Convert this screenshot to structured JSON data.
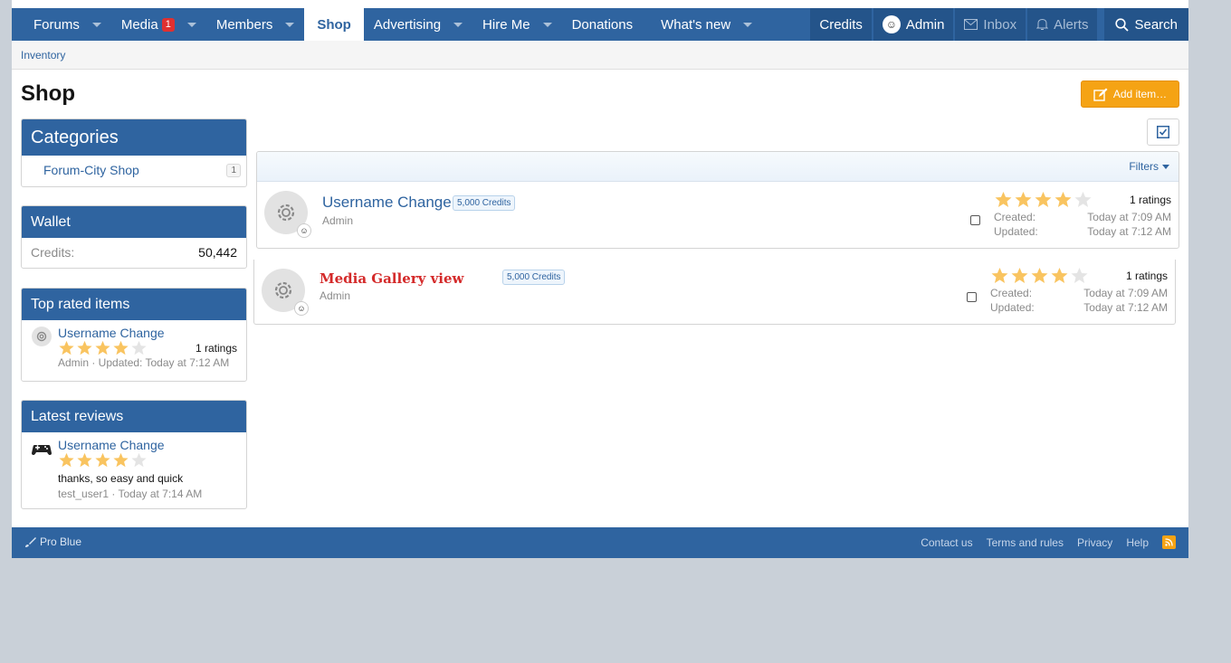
{
  "nav": {
    "items": [
      {
        "label": "Forums",
        "caret": true
      },
      {
        "label": "Media",
        "badge": "1",
        "caret": true
      },
      {
        "label": "Members",
        "caret": true
      },
      {
        "label": "Shop",
        "active": true
      },
      {
        "label": "Advertising",
        "caret": true
      },
      {
        "label": "Hire Me",
        "caret": true
      },
      {
        "label": "Donations"
      },
      {
        "label": "What's new",
        "caret": true
      }
    ],
    "credits": "Credits",
    "user": "Admin",
    "inbox": "Inbox",
    "alerts": "Alerts",
    "search": "Search"
  },
  "subnav": {
    "inventory": "Inventory"
  },
  "page": {
    "title": "Shop",
    "add_item": "Add item…"
  },
  "sidebar": {
    "categories": {
      "title": "Categories",
      "item": "Forum-City Shop",
      "count": "1"
    },
    "wallet": {
      "title": "Wallet",
      "label": "Credits:",
      "value": "50,442"
    },
    "top_rated": {
      "title": "Top rated items",
      "item": "Username Change",
      "ratings": "1 ratings",
      "rating_value": 4,
      "meta": "Admin · Updated: Today at 7:12 AM"
    },
    "latest_reviews": {
      "title": "Latest reviews",
      "item": "Username Change",
      "rating_value": 4,
      "text": "thanks, so easy and quick",
      "meta": "test_user1 · Today at 7:14 AM"
    }
  },
  "list": {
    "filters": "Filters",
    "items": [
      {
        "title": "Username Change",
        "price": "5,000 Credits",
        "author": "Admin",
        "rating_value": 4,
        "ratings": "1 ratings",
        "created_label": "Created:",
        "created": "Today at 7:09 AM",
        "updated_label": "Updated:",
        "updated": "Today at 7:12 AM"
      },
      {
        "title": "Media Gallery view",
        "price": "5,000 Credits",
        "author": "Admin",
        "rating_value": 4,
        "ratings": "1 ratings",
        "created_label": "Created:",
        "created": "Today at 7:09 AM",
        "updated_label": "Updated:",
        "updated": "Today at 7:12 AM"
      }
    ]
  },
  "footer": {
    "style": "Pro Blue",
    "links": [
      "Contact us",
      "Terms and rules",
      "Privacy",
      "Help"
    ]
  },
  "colors": {
    "brand": "#2f64a0",
    "accent": "#f5a314",
    "star": "#f9c460"
  }
}
